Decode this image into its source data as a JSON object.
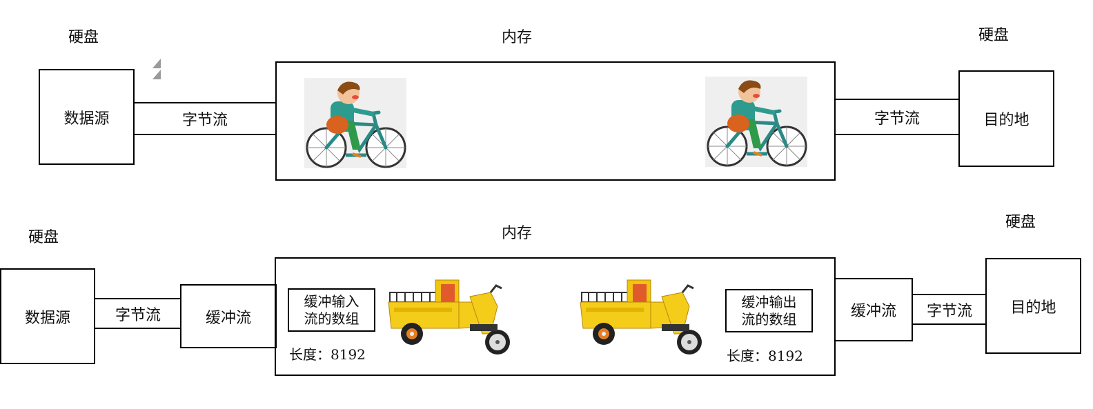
{
  "top": {
    "source_disk_label": "硬盘",
    "memory_label": "内存",
    "dest_disk_label": "硬盘",
    "source_box": "数据源",
    "stream_left": "字节流",
    "stream_right": "字节流",
    "dest_box": "目的地"
  },
  "bottom": {
    "source_disk_label": "硬盘",
    "memory_label": "内存",
    "dest_disk_label": "硬盘",
    "source_box": "数据源",
    "byte_stream_left": "字节流",
    "buffer_stream_left": "缓冲流",
    "input_array": "缓冲输入\n流的数组",
    "input_length": "长度：8192",
    "output_array": "缓冲输出\n流的数组",
    "output_length": "长度：8192",
    "buffer_stream_right": "缓冲流",
    "byte_stream_right": "字节流",
    "dest_box": "目的地"
  },
  "icons": {
    "bicycle": "boy-on-bicycle-icon",
    "tricycle": "cargo-tricycle-icon"
  }
}
